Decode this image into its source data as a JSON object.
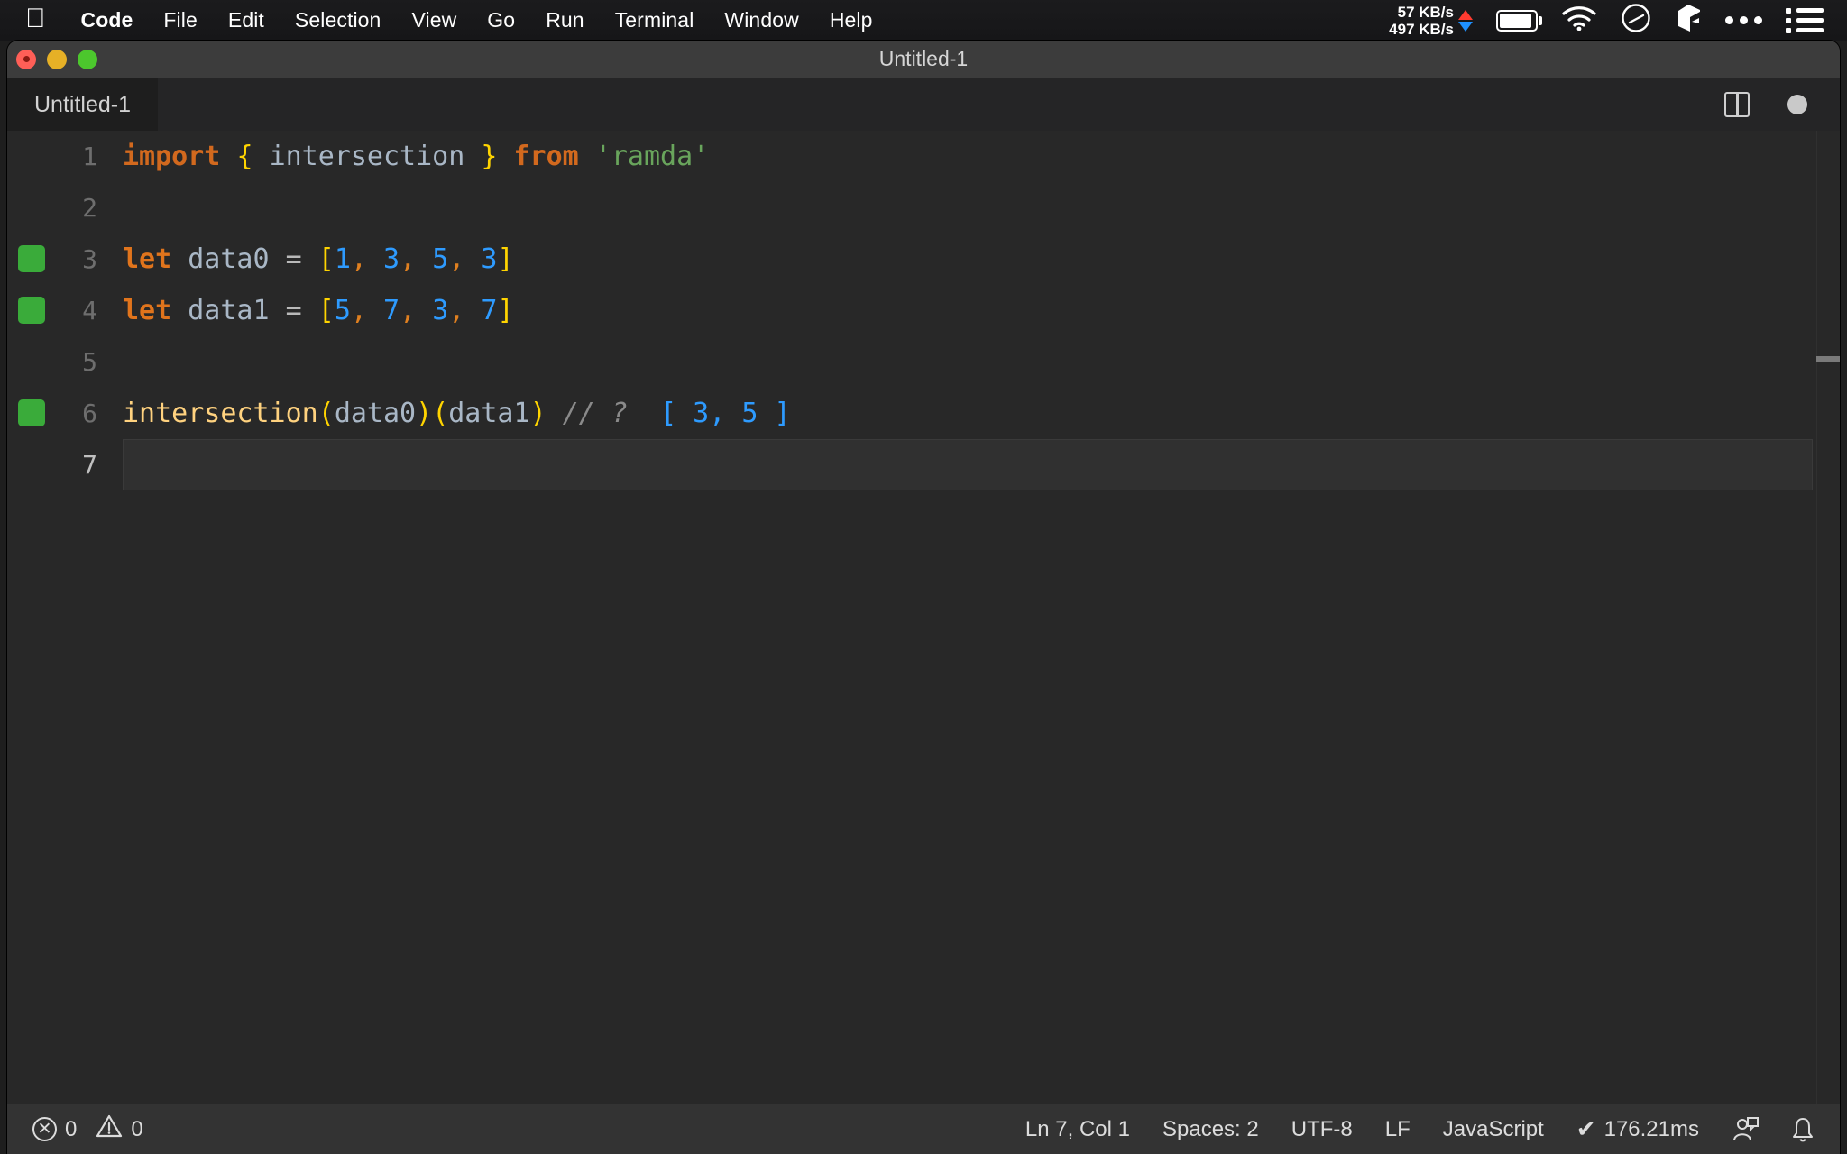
{
  "menubar": {
    "apple_glyph": "",
    "items": [
      {
        "label": "Code",
        "bold": true
      },
      {
        "label": "File",
        "bold": false
      },
      {
        "label": "Edit",
        "bold": false
      },
      {
        "label": "Selection",
        "bold": false
      },
      {
        "label": "View",
        "bold": false
      },
      {
        "label": "Go",
        "bold": false
      },
      {
        "label": "Run",
        "bold": false
      },
      {
        "label": "Terminal",
        "bold": false
      },
      {
        "label": "Window",
        "bold": false
      },
      {
        "label": "Help",
        "bold": false
      }
    ],
    "status": {
      "net_up": "57 KB/s",
      "net_down": "497 KB/s",
      "up_color": "#ff3b30",
      "down_color": "#1e90ff",
      "icons": [
        "battery-icon",
        "wifi-icon",
        "gauge-icon",
        "cube-icon",
        "ellipsis-icon",
        "control-center-icon"
      ]
    }
  },
  "window": {
    "title": "Untitled-1",
    "traffic_lights": [
      "close",
      "minimize",
      "zoom"
    ]
  },
  "tabbar": {
    "tab_label": "Untitled-1",
    "actions": [
      "split-editor-icon",
      "unsaved-dot"
    ]
  },
  "editor": {
    "language": "JavaScript",
    "lines": [
      {
        "number": "1",
        "marker": false,
        "active": false,
        "tokens": [
          {
            "t": "import",
            "c": "kw"
          },
          {
            "t": " ",
            "c": "op"
          },
          {
            "t": "{",
            "c": "brace"
          },
          {
            "t": " ",
            "c": "op"
          },
          {
            "t": "intersection",
            "c": "ident"
          },
          {
            "t": " ",
            "c": "op"
          },
          {
            "t": "}",
            "c": "brace"
          },
          {
            "t": " ",
            "c": "op"
          },
          {
            "t": "from",
            "c": "kw"
          },
          {
            "t": " ",
            "c": "op"
          },
          {
            "t": "'ramda'",
            "c": "str"
          }
        ]
      },
      {
        "number": "2",
        "marker": false,
        "active": false,
        "tokens": []
      },
      {
        "number": "3",
        "marker": true,
        "active": false,
        "tokens": [
          {
            "t": "let",
            "c": "kw2"
          },
          {
            "t": " ",
            "c": "op"
          },
          {
            "t": "data0",
            "c": "ident"
          },
          {
            "t": " ",
            "c": "op"
          },
          {
            "t": "=",
            "c": "op"
          },
          {
            "t": " ",
            "c": "op"
          },
          {
            "t": "[",
            "c": "brace"
          },
          {
            "t": "1",
            "c": "num"
          },
          {
            "t": ",",
            "c": "comma"
          },
          {
            "t": " ",
            "c": "op"
          },
          {
            "t": "3",
            "c": "num"
          },
          {
            "t": ",",
            "c": "comma"
          },
          {
            "t": " ",
            "c": "op"
          },
          {
            "t": "5",
            "c": "num"
          },
          {
            "t": ",",
            "c": "comma"
          },
          {
            "t": " ",
            "c": "op"
          },
          {
            "t": "3",
            "c": "num"
          },
          {
            "t": "]",
            "c": "brace"
          }
        ]
      },
      {
        "number": "4",
        "marker": true,
        "active": false,
        "tokens": [
          {
            "t": "let",
            "c": "kw2"
          },
          {
            "t": " ",
            "c": "op"
          },
          {
            "t": "data1",
            "c": "ident"
          },
          {
            "t": " ",
            "c": "op"
          },
          {
            "t": "=",
            "c": "op"
          },
          {
            "t": " ",
            "c": "op"
          },
          {
            "t": "[",
            "c": "brace"
          },
          {
            "t": "5",
            "c": "num"
          },
          {
            "t": ",",
            "c": "comma"
          },
          {
            "t": " ",
            "c": "op"
          },
          {
            "t": "7",
            "c": "num"
          },
          {
            "t": ",",
            "c": "comma"
          },
          {
            "t": " ",
            "c": "op"
          },
          {
            "t": "3",
            "c": "num"
          },
          {
            "t": ",",
            "c": "comma"
          },
          {
            "t": " ",
            "c": "op"
          },
          {
            "t": "7",
            "c": "num"
          },
          {
            "t": "]",
            "c": "brace"
          }
        ]
      },
      {
        "number": "5",
        "marker": false,
        "active": false,
        "tokens": []
      },
      {
        "number": "6",
        "marker": true,
        "active": false,
        "tokens": [
          {
            "t": "intersection",
            "c": "fn"
          },
          {
            "t": "(",
            "c": "brace"
          },
          {
            "t": "data0",
            "c": "ident"
          },
          {
            "t": ")",
            "c": "brace"
          },
          {
            "t": "(",
            "c": "brace"
          },
          {
            "t": "data1",
            "c": "ident"
          },
          {
            "t": ")",
            "c": "brace"
          },
          {
            "t": " ",
            "c": "op"
          },
          {
            "t": "// ?",
            "c": "comment"
          },
          {
            "t": "  ",
            "c": "op"
          },
          {
            "t": "[ 3, 5 ]",
            "c": "result"
          }
        ]
      },
      {
        "number": "7",
        "marker": false,
        "active": true,
        "tokens": []
      }
    ]
  },
  "statusbar": {
    "errors": "0",
    "warnings": "0",
    "cursor": "Ln 7, Col 1",
    "indent": "Spaces: 2",
    "encoding": "UTF-8",
    "eol": "LF",
    "language": "JavaScript",
    "quokka_time": "176.21ms",
    "quokka_check": "✔",
    "right_icons": [
      "feedback-icon",
      "bell-icon"
    ]
  }
}
